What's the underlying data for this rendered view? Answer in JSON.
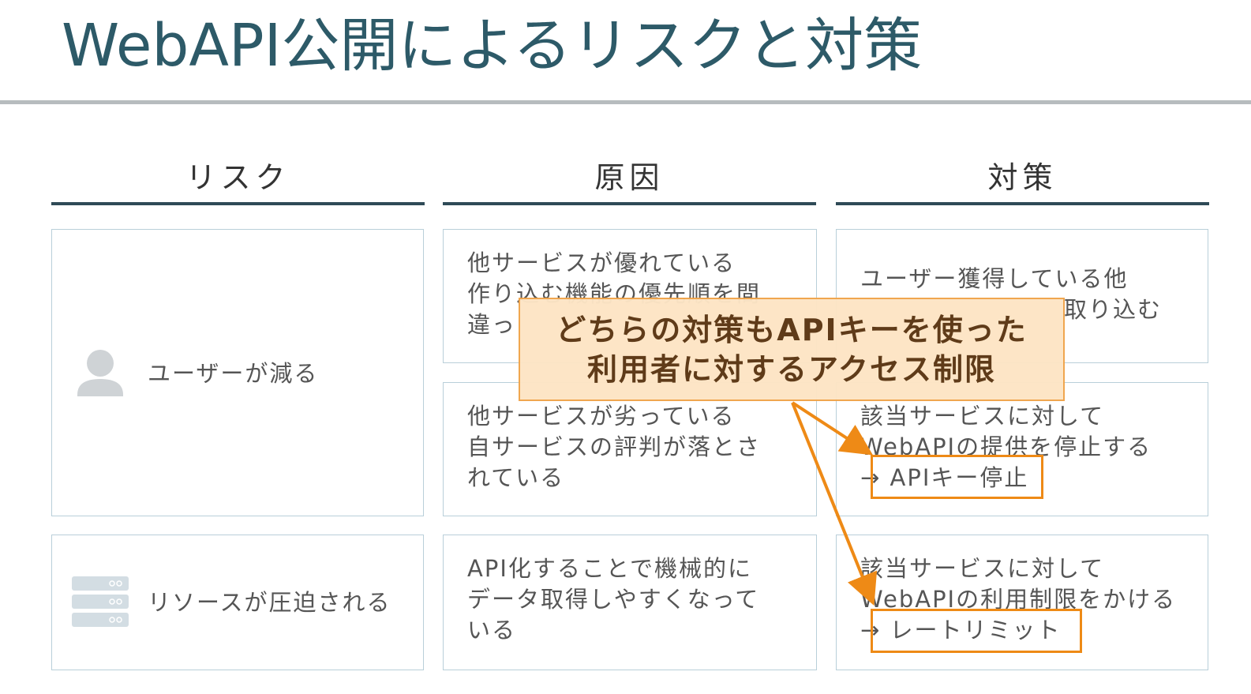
{
  "slide": {
    "title": "WebAPI公開によるリスクと対策"
  },
  "columns": {
    "risk": "リスク",
    "cause": "原因",
    "countermeasure": "対策"
  },
  "risks": {
    "r1": {
      "label": "ユーザーが減る",
      "icon": "user-icon"
    },
    "r2": {
      "label": "リソースが圧迫される",
      "icon": "server-icon"
    }
  },
  "causes": {
    "c1": "他サービスが優れている\n作り込む機能の優先順を間\n違っ",
    "c2": "他サービスが劣っている\n自サービスの評判が落とさ\nれている",
    "c3": "API化することで機械的に\nデータ取得しやすくなって\nいる"
  },
  "countermeasures": {
    "m1_line1": "ユーザー獲得している他",
    "m1_line2": "取り込む",
    "m2": "該当サービスに対して\nWebAPIの提供を停止する\n→ APIキー停止",
    "m3": "該当サービスに対して\nWebAPIの利用制限をかける\n→ レートリミット"
  },
  "callout": {
    "line1": "どちらの対策もAPIキーを使った",
    "line2": "利用者に対するアクセス制限"
  },
  "colors": {
    "title": "#2d5a68",
    "accent_orange": "#ee8a16",
    "callout_fill": "#fde5c5",
    "rule_dark": "#2f4a57",
    "box_border": "#b9cfd9"
  }
}
